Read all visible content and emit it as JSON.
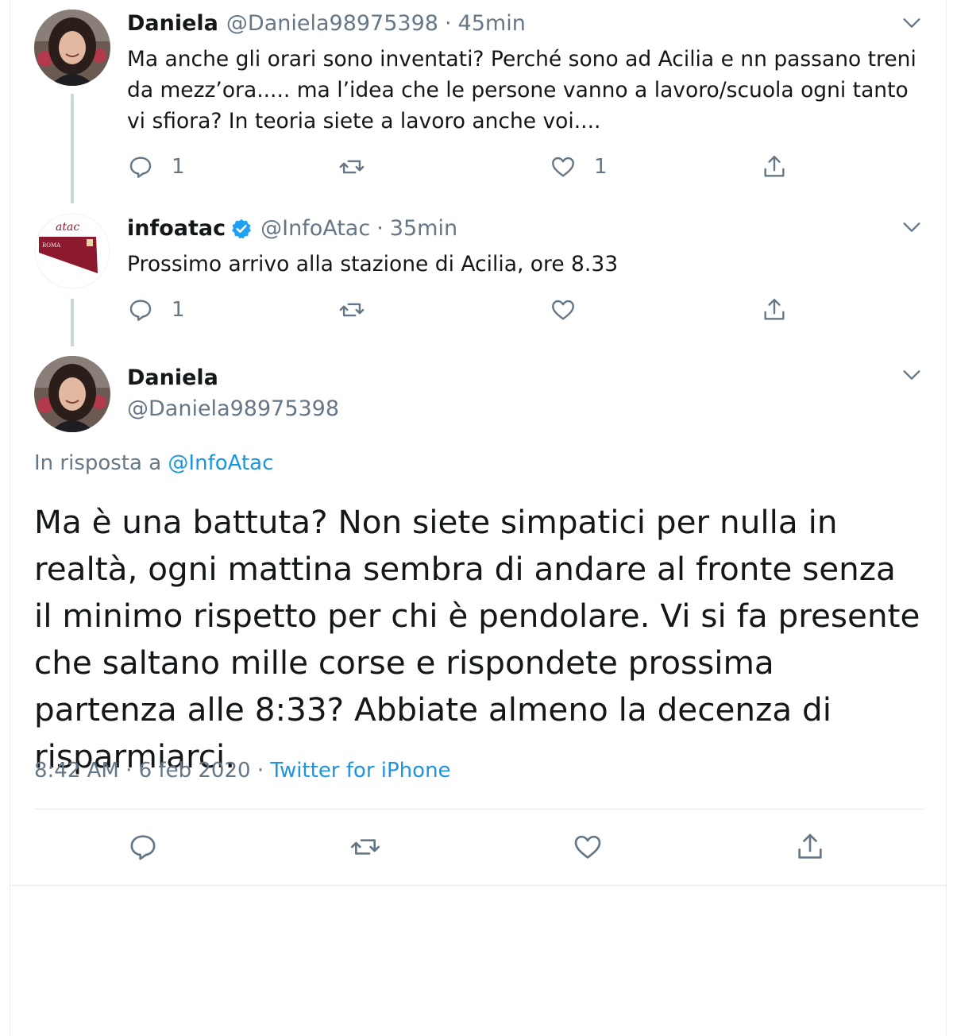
{
  "tweets": [
    {
      "author_name": "Daniela",
      "author_handle": "@Daniela98975398",
      "time_sep": "·",
      "time": "45min",
      "text": "Ma anche gli orari sono inventati? Perché sono ad Acilia e nn passano treni da mezz’ora..... ma l’idea che le persone vanno a lavoro/scuola ogni tanto vi sfiora? In teoria siete a lavoro anche voi....",
      "reply_count": "1",
      "retweet_count": "",
      "like_count": "1"
    },
    {
      "author_name": "infoatac",
      "author_handle": "@InfoAtac",
      "time_sep": "·",
      "time": "35min",
      "verified": true,
      "text": "Prossimo arrivo alla stazione di Acilia, ore 8.33",
      "reply_count": "1",
      "retweet_count": "",
      "like_count": ""
    }
  ],
  "main_tweet": {
    "author_name": "Daniela",
    "author_handle": "@Daniela98975398",
    "in_reply_prefix": "In risposta a",
    "in_reply_handle": "@InfoAtac",
    "text": "Ma è una battuta? Non siete simpatici per nulla in realtà, ogni mattina sembra di andare al fronte senza il minimo rispetto per chi è pendolare. Vi si fa presente che saltano mille corse e rispondete prossima partenza alle 8:33? Abbiate almeno la decenza di risparmiarci.",
    "timestamp": "8:42 AM · 6 feb 2020 ·",
    "source": "Twitter for iPhone"
  },
  "logo": {
    "text_top": "atac",
    "text_band": "ROMA",
    "colors": {
      "band": "#8b1a2e",
      "text": "#8b1a2e"
    }
  },
  "icons": {
    "reply": "reply-icon",
    "retweet": "retweet-icon",
    "like": "heart-icon",
    "share": "share-icon",
    "menu": "chevron-down-icon",
    "verified": "verified-badge-icon"
  },
  "colors": {
    "text": "#14171a",
    "secondary": "#657786",
    "link": "#1b95e0",
    "icon": "#657786",
    "thread_line": "#ccd6dd",
    "divider": "#e6ecf0",
    "verified": "#1da1f2"
  }
}
